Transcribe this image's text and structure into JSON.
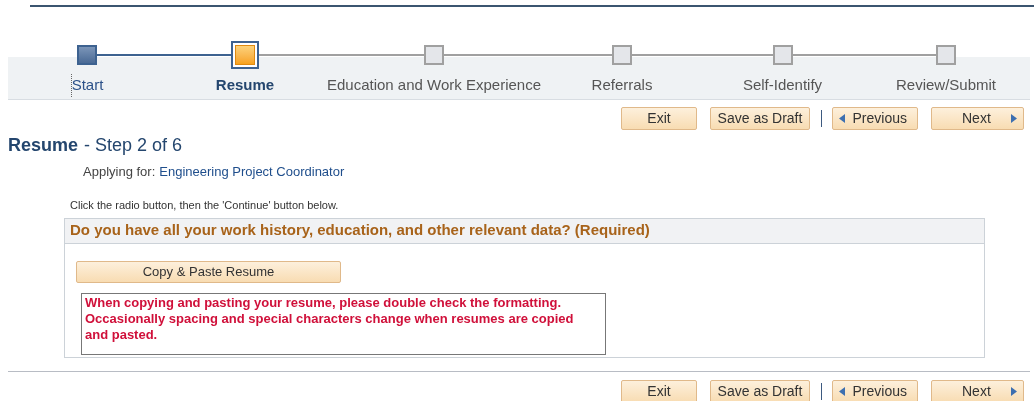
{
  "steps": [
    {
      "label": "Start",
      "selected": false,
      "completed": true
    },
    {
      "label": "Resume",
      "selected": true,
      "completed": false
    },
    {
      "label": "Education and Work Experience",
      "selected": false,
      "completed": false
    },
    {
      "label": "Referrals",
      "selected": false,
      "completed": false
    },
    {
      "label": "Self-Identify",
      "selected": false,
      "completed": false
    },
    {
      "label": "Review/Submit",
      "selected": false,
      "completed": false
    }
  ],
  "top_nav": [
    {
      "label": "Exit",
      "kind": "plain"
    },
    {
      "label": "Save as Draft",
      "kind": "plain"
    },
    {
      "label": "Previous",
      "kind": "previous"
    },
    {
      "label": "Next",
      "kind": "next"
    }
  ],
  "heading": {
    "title": "Resume",
    "subtitle": "- Step 2 of 6"
  },
  "applying_for": {
    "label": "Applying for:",
    "value": "Engineering Project Coordinator"
  },
  "instruction": "Click the radio button, then the 'Continue' button below.",
  "panel": {
    "question": "Do you have all your work history, education, and other relevant data? (Required)",
    "button": "Copy & Paste Resume",
    "warning": "When copying and pasting your resume, please double check the formatting. Occasionally spacing and special characters change when resumes are copied and pasted."
  },
  "bottom_nav": [
    {
      "label": "Exit",
      "kind": "plain"
    },
    {
      "label": "Save as Draft",
      "kind": "plain"
    },
    {
      "label": "Previous",
      "kind": "previous"
    },
    {
      "label": "Next",
      "kind": "next"
    }
  ]
}
